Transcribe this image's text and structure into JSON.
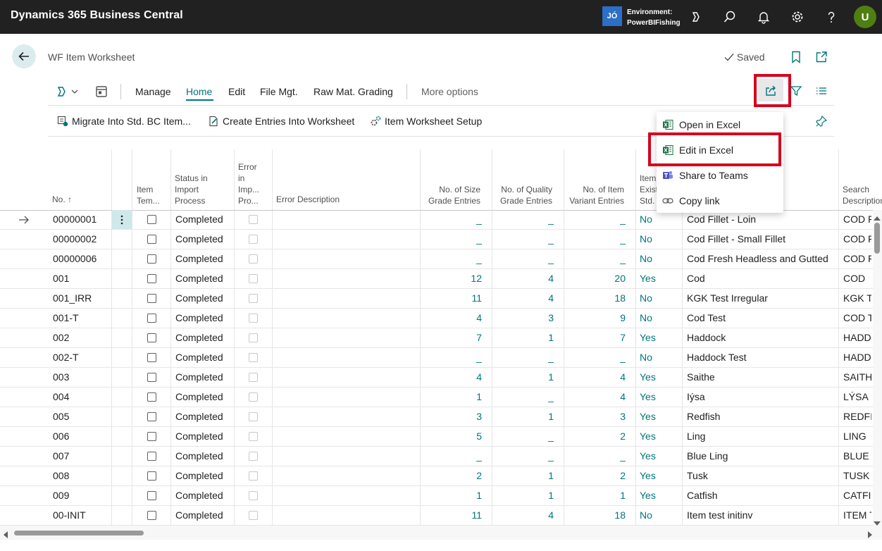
{
  "app": {
    "title": "Dynamics 365 Business Central"
  },
  "env": {
    "badge": "JÓ",
    "label": "Environment:",
    "name": "PowerBIFishing"
  },
  "user": {
    "initial": "U"
  },
  "page": {
    "title": "WF Item Worksheet",
    "saved": "Saved"
  },
  "actions": {
    "manage": "Manage",
    "home": "Home",
    "edit": "Edit",
    "filemgt": "File Mgt.",
    "rawmat": "Raw Mat. Grading",
    "more": "More options"
  },
  "promoted": {
    "migrate": "Migrate Into Std. BC Item...",
    "create": "Create Entries Into Worksheet",
    "setup": "Item Worksheet Setup"
  },
  "menu": {
    "open_excel": "Open in Excel",
    "edit_excel": "Edit in Excel",
    "share_teams": "Share to Teams",
    "copy_link": "Copy link"
  },
  "columns": {
    "no": "No. ↑",
    "item_tem": [
      "Item",
      "Tem..."
    ],
    "status": [
      "Status in",
      "Import",
      "Process"
    ],
    "error": [
      "Error",
      "in",
      "Imp...",
      "Pro..."
    ],
    "error_desc": "Error Description",
    "size": [
      "No. of Size",
      "Grade Entries"
    ],
    "quality": [
      "No. of Quality",
      "Grade Entries"
    ],
    "variant": [
      "No. of Item",
      "Variant Entries"
    ],
    "exist": [
      "Item",
      "Exist",
      "Std."
    ],
    "search": [
      "Search",
      "Description"
    ]
  },
  "colors": {
    "accent": "#00757c",
    "topbar": "#212121",
    "highlight": "#d6001c"
  },
  "rows": [
    {
      "no": "00000001",
      "status": "Completed",
      "size": "_",
      "quality": "_",
      "variant": "_",
      "exist": "No",
      "desc": "Cod Fillet - Loin",
      "search": "COD F"
    },
    {
      "no": "00000002",
      "status": "Completed",
      "size": "_",
      "quality": "_",
      "variant": "_",
      "exist": "No",
      "desc": "Cod Fillet - Small Fillet",
      "search": "COD F"
    },
    {
      "no": "00000006",
      "status": "Completed",
      "size": "_",
      "quality": "_",
      "variant": "_",
      "exist": "No",
      "desc": "Cod Fresh Headless and Gutted",
      "search": "COD F"
    },
    {
      "no": "001",
      "status": "Completed",
      "size": "12",
      "quality": "4",
      "variant": "20",
      "exist": "Yes",
      "desc": "Cod",
      "search": "COD"
    },
    {
      "no": "001_IRR",
      "status": "Completed",
      "size": "11",
      "quality": "4",
      "variant": "18",
      "exist": "No",
      "desc": "KGK Test Irregular",
      "search": "KGK TE"
    },
    {
      "no": "001-T",
      "status": "Completed",
      "size": "4",
      "quality": "3",
      "variant": "9",
      "exist": "No",
      "desc": "Cod Test",
      "search": "COD T"
    },
    {
      "no": "002",
      "status": "Completed",
      "size": "7",
      "quality": "1",
      "variant": "7",
      "exist": "Yes",
      "desc": "Haddock",
      "search": "HADD"
    },
    {
      "no": "002-T",
      "status": "Completed",
      "size": "_",
      "quality": "_",
      "variant": "_",
      "exist": "No",
      "desc": "Haddock Test",
      "search": "HADD"
    },
    {
      "no": "003",
      "status": "Completed",
      "size": "4",
      "quality": "1",
      "variant": "4",
      "exist": "Yes",
      "desc": "Saithe",
      "search": "SAITH"
    },
    {
      "no": "004",
      "status": "Completed",
      "size": "1",
      "quality": "_",
      "variant": "4",
      "exist": "Yes",
      "desc": "Iýsa",
      "search": "LÝSA"
    },
    {
      "no": "005",
      "status": "Completed",
      "size": "3",
      "quality": "1",
      "variant": "3",
      "exist": "Yes",
      "desc": "Redfish",
      "search": "REDFIS"
    },
    {
      "no": "006",
      "status": "Completed",
      "size": "5",
      "quality": "_",
      "variant": "2",
      "exist": "Yes",
      "desc": "Ling",
      "search": "LING"
    },
    {
      "no": "007",
      "status": "Completed",
      "size": "_",
      "quality": "_",
      "variant": "_",
      "exist": "Yes",
      "desc": "Blue Ling",
      "search": "BLUE L"
    },
    {
      "no": "008",
      "status": "Completed",
      "size": "2",
      "quality": "1",
      "variant": "2",
      "exist": "Yes",
      "desc": "Tusk",
      "search": "TUSK"
    },
    {
      "no": "009",
      "status": "Completed",
      "size": "1",
      "quality": "1",
      "variant": "1",
      "exist": "Yes",
      "desc": "Catfish",
      "search": "CATFIS"
    },
    {
      "no": "00-INIT",
      "status": "Completed",
      "size": "11",
      "quality": "4",
      "variant": "18",
      "exist": "No",
      "desc": "Item test initinv",
      "search": "ITEM T"
    }
  ]
}
